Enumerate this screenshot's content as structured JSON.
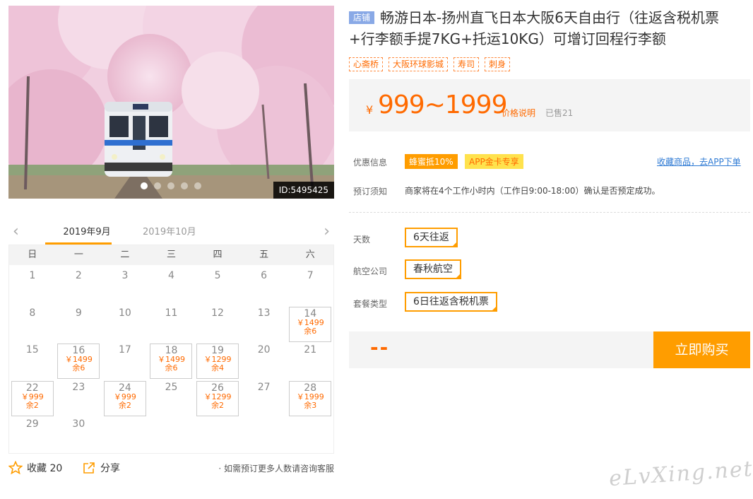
{
  "photo": {
    "id_label": "ID:5495425",
    "slide_count": 5,
    "active_slide": 1
  },
  "calendar": {
    "tabs": [
      "2019年9月",
      "2019年10月"
    ],
    "weekdays": [
      "日",
      "一",
      "二",
      "三",
      "四",
      "五",
      "六"
    ],
    "leading_blanks": 0,
    "days": [
      {
        "d": "1"
      },
      {
        "d": "2"
      },
      {
        "d": "3"
      },
      {
        "d": "4"
      },
      {
        "d": "5"
      },
      {
        "d": "6"
      },
      {
        "d": "7"
      },
      {
        "d": "8"
      },
      {
        "d": "9"
      },
      {
        "d": "10"
      },
      {
        "d": "11"
      },
      {
        "d": "12"
      },
      {
        "d": "13"
      },
      {
        "d": "14",
        "price": "￥1499",
        "stock": "余6"
      },
      {
        "d": "15"
      },
      {
        "d": "16",
        "price": "￥1499",
        "stock": "余6"
      },
      {
        "d": "17"
      },
      {
        "d": "18",
        "price": "￥1499",
        "stock": "余6"
      },
      {
        "d": "19",
        "price": "￥1299",
        "stock": "余4"
      },
      {
        "d": "20"
      },
      {
        "d": "21"
      },
      {
        "d": "22",
        "price": "￥999",
        "stock": "余2"
      },
      {
        "d": "23"
      },
      {
        "d": "24",
        "price": "￥999",
        "stock": "余2"
      },
      {
        "d": "25"
      },
      {
        "d": "26",
        "price": "￥1299",
        "stock": "余2"
      },
      {
        "d": "27"
      },
      {
        "d": "28",
        "price": "￥1999",
        "stock": "余3"
      },
      {
        "d": "29"
      },
      {
        "d": "30"
      }
    ]
  },
  "actions": {
    "favorite_label": "收藏 20",
    "share_label": "分享",
    "notice": "· 如需预订更多人数请咨询客服"
  },
  "product": {
    "shop_badge": "店铺",
    "title": "畅游日本-扬州直飞日本大阪6天自由行（往返含税机票+行李额手提7KG+托运10KG）可增订回程行李额",
    "tags": [
      "心斋桥",
      "大阪环球影城",
      "寿司",
      "刺身"
    ]
  },
  "price": {
    "currency": "¥",
    "range": "999~1999",
    "note": "价格说明",
    "sold": "已售21"
  },
  "promo": {
    "label": "优惠信息",
    "badge_a": "蜂蜜抵10%",
    "badge_b": "APP金卡专享",
    "fav_link": "收藏商品，去APP下单"
  },
  "booking": {
    "label": "预订须知",
    "text": "商家将在4个工作小时内（工作日9:00-18:00）确认是否预定成功。"
  },
  "options": [
    {
      "label": "天数",
      "value": "6天往返"
    },
    {
      "label": "航空公司",
      "value": "春秋航空"
    },
    {
      "label": "套餐类型",
      "value": "6日往返含税机票"
    }
  ],
  "buy": {
    "qty_placeholder": "--",
    "button": "立即购买"
  },
  "watermark": "eLvXing.net",
  "colors": {
    "accent": "#ff9d00",
    "price": "#ff6a00",
    "link": "#2e7ad4",
    "badge": "#89a9e6"
  }
}
